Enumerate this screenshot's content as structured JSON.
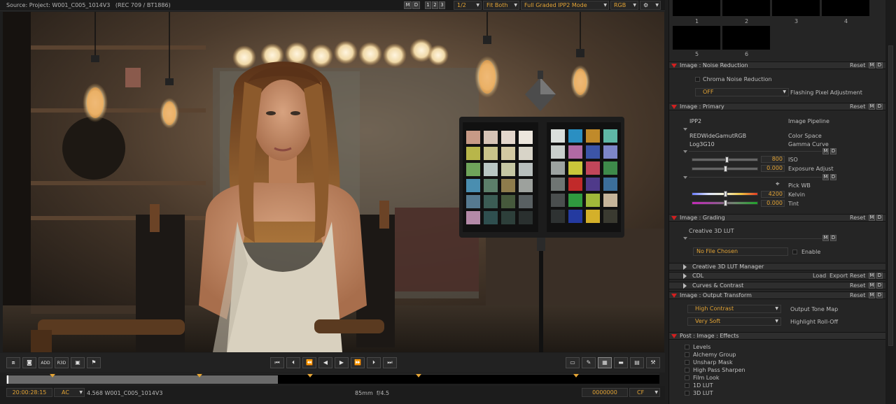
{
  "topbar": {
    "source": "Source: Project: W001_C005_1014V3",
    "colorspace": "(REC 709 / BT1886)",
    "m": "M",
    "d": "D",
    "view1": "1",
    "view2": "2",
    "view3": "3",
    "resolution": "1/2",
    "fit": "Fit Both",
    "mode": "Full Graded IPP2 Mode",
    "channel": "RGB"
  },
  "transport": {
    "add": "ADD",
    "r3d": "R3D"
  },
  "status": {
    "timecode": "20:00:28:15",
    "tc_mode": "AC",
    "clip": "4.568 W001_C005_1014V3",
    "lens": "85mm",
    "aperture": "f/4.5",
    "frame": "0000000",
    "frame_mode": "CF"
  },
  "timeline": {
    "progress_fraction": 0.416
  },
  "thumbs": [
    "1",
    "2",
    "3",
    "4",
    "5",
    "6"
  ],
  "panel": {
    "noise": {
      "title": "Image : Noise Reduction",
      "reset": "Reset",
      "m": "M",
      "d": "D",
      "chroma": "Chroma Noise Reduction",
      "flashing_value": "OFF",
      "flashing_label": "Flashing Pixel Adjustment"
    },
    "primary": {
      "title": "Image : Primary",
      "reset": "Reset",
      "m": "M",
      "d": "D",
      "pipeline_value": "IPP2",
      "pipeline_label": "Image Pipeline",
      "colorspace_value": "REDWideGamutRGB",
      "colorspace_label": "Color Space",
      "gamma_value": "Log3G10",
      "gamma_label": "Gamma Curve",
      "iso_value": "800",
      "iso_label": "ISO",
      "exposure_value": "0.000",
      "exposure_label": "Exposure Adjust",
      "pickwb_label": "Pick WB",
      "kelvin_value": "4200",
      "kelvin_label": "Kelvin",
      "tint_value": "0.000",
      "tint_label": "Tint"
    },
    "grading": {
      "title": "Image : Grading",
      "reset": "Reset",
      "m": "M",
      "d": "D",
      "lut_label": "Creative 3D LUT",
      "file_value": "No File Chosen",
      "enable_label": "Enable",
      "lut_manager": "Creative 3D LUT Manager",
      "cdl": "CDL",
      "load": "Load",
      "export": "Export",
      "curves": "Curves & Contrast"
    },
    "output": {
      "title": "Image : Output Transform",
      "reset": "Reset",
      "m": "M",
      "d": "D",
      "tonemap_value": "High Contrast",
      "tonemap_label": "Output Tone Map",
      "rolloff_value": "Very Soft",
      "rolloff_label": "Highlight Roll-Off"
    },
    "effects": {
      "title": "Post : Image : Effects",
      "items": [
        "Levels",
        "Alchemy Group",
        "Unsharp Mask",
        "High Pass Sharpen",
        "Film Look",
        "1D LUT",
        "3D LUT"
      ]
    }
  }
}
